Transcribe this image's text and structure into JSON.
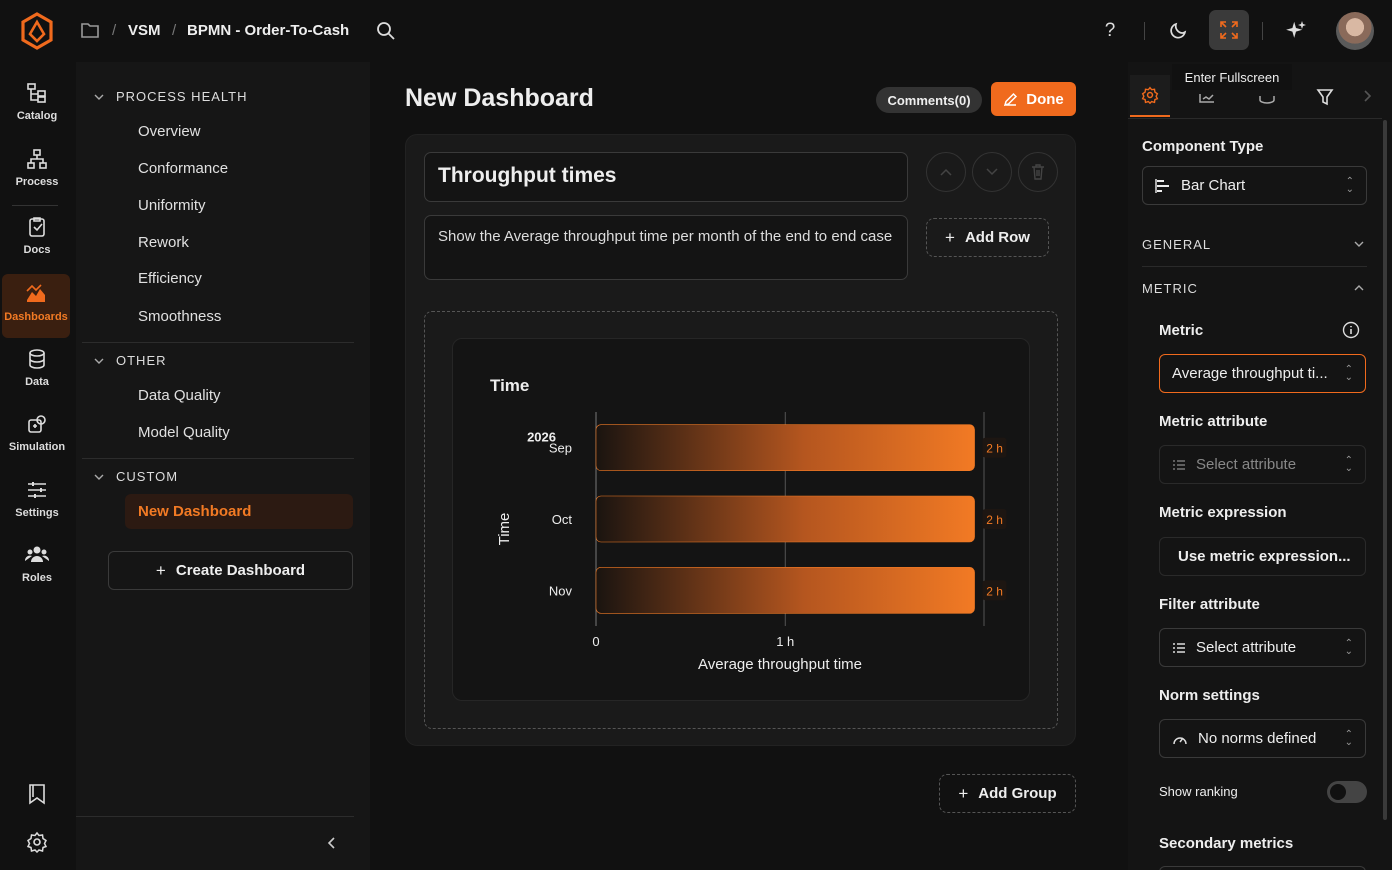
{
  "breadcrumb": {
    "root": "VSM",
    "page": "BPMN - Order-To-Cash"
  },
  "tooltip": "Enter Fullscreen",
  "rail": [
    {
      "label": "Catalog",
      "icon": "catalog-icon"
    },
    {
      "label": "Process",
      "icon": "process-icon"
    },
    {
      "label": "Docs",
      "icon": "docs-icon"
    },
    {
      "label": "Dashboards",
      "icon": "dashboards-icon"
    },
    {
      "label": "Data",
      "icon": "data-icon"
    },
    {
      "label": "Simulation",
      "icon": "simulation-icon"
    },
    {
      "label": "Settings",
      "icon": "settings-icon"
    },
    {
      "label": "Roles",
      "icon": "roles-icon"
    }
  ],
  "nav": {
    "process_health": {
      "title": "PROCESS HEALTH",
      "items": [
        "Overview",
        "Conformance",
        "Uniformity",
        "Rework",
        "Efficiency",
        "Smoothness"
      ]
    },
    "other": {
      "title": "OTHER",
      "items": [
        "Data Quality",
        "Model Quality"
      ]
    },
    "custom": {
      "title": "CUSTOM",
      "items": [
        "New Dashboard"
      ]
    },
    "create_label": "Create Dashboard"
  },
  "main": {
    "title": "New Dashboard",
    "comments": "Comments(0)",
    "done": "Done",
    "widget_title": "Throughput times",
    "widget_desc": "Show the Average throughput time per month of the end to end case",
    "add_row": "Add Row",
    "add_group": "Add Group"
  },
  "chart_data": {
    "type": "bar",
    "orientation": "horizontal",
    "title": "Time",
    "year_label": "2026",
    "categories": [
      "Sep",
      "Oct",
      "Nov"
    ],
    "values": [
      2,
      2,
      2
    ],
    "value_labels": [
      "2 h",
      "2 h",
      "2 h"
    ],
    "ylabel": "Time",
    "xlabel": "Average throughput time",
    "x_ticks": [
      "0",
      "1 h"
    ],
    "xlim": [
      0,
      2.05
    ],
    "bar_color": "#f27a24"
  },
  "panel": {
    "component_type_label": "Component Type",
    "component_type_value": "Bar Chart",
    "general": "GENERAL",
    "metric_section": "METRIC",
    "metric_label": "Metric",
    "metric_value": "Average throughput ti...",
    "metric_attr_label": "Metric attribute",
    "metric_attr_placeholder": "Select attribute",
    "metric_expr_label": "Metric expression",
    "metric_expr_button": "Use metric expression...",
    "filter_attr_label": "Filter attribute",
    "filter_attr_value": "Select attribute",
    "norm_label": "Norm settings",
    "norm_value": "No norms defined",
    "ranking_label": "Show ranking",
    "secondary_label": "Secondary metrics"
  },
  "colors": {
    "accent": "#f06a1d",
    "background": "#111111"
  }
}
